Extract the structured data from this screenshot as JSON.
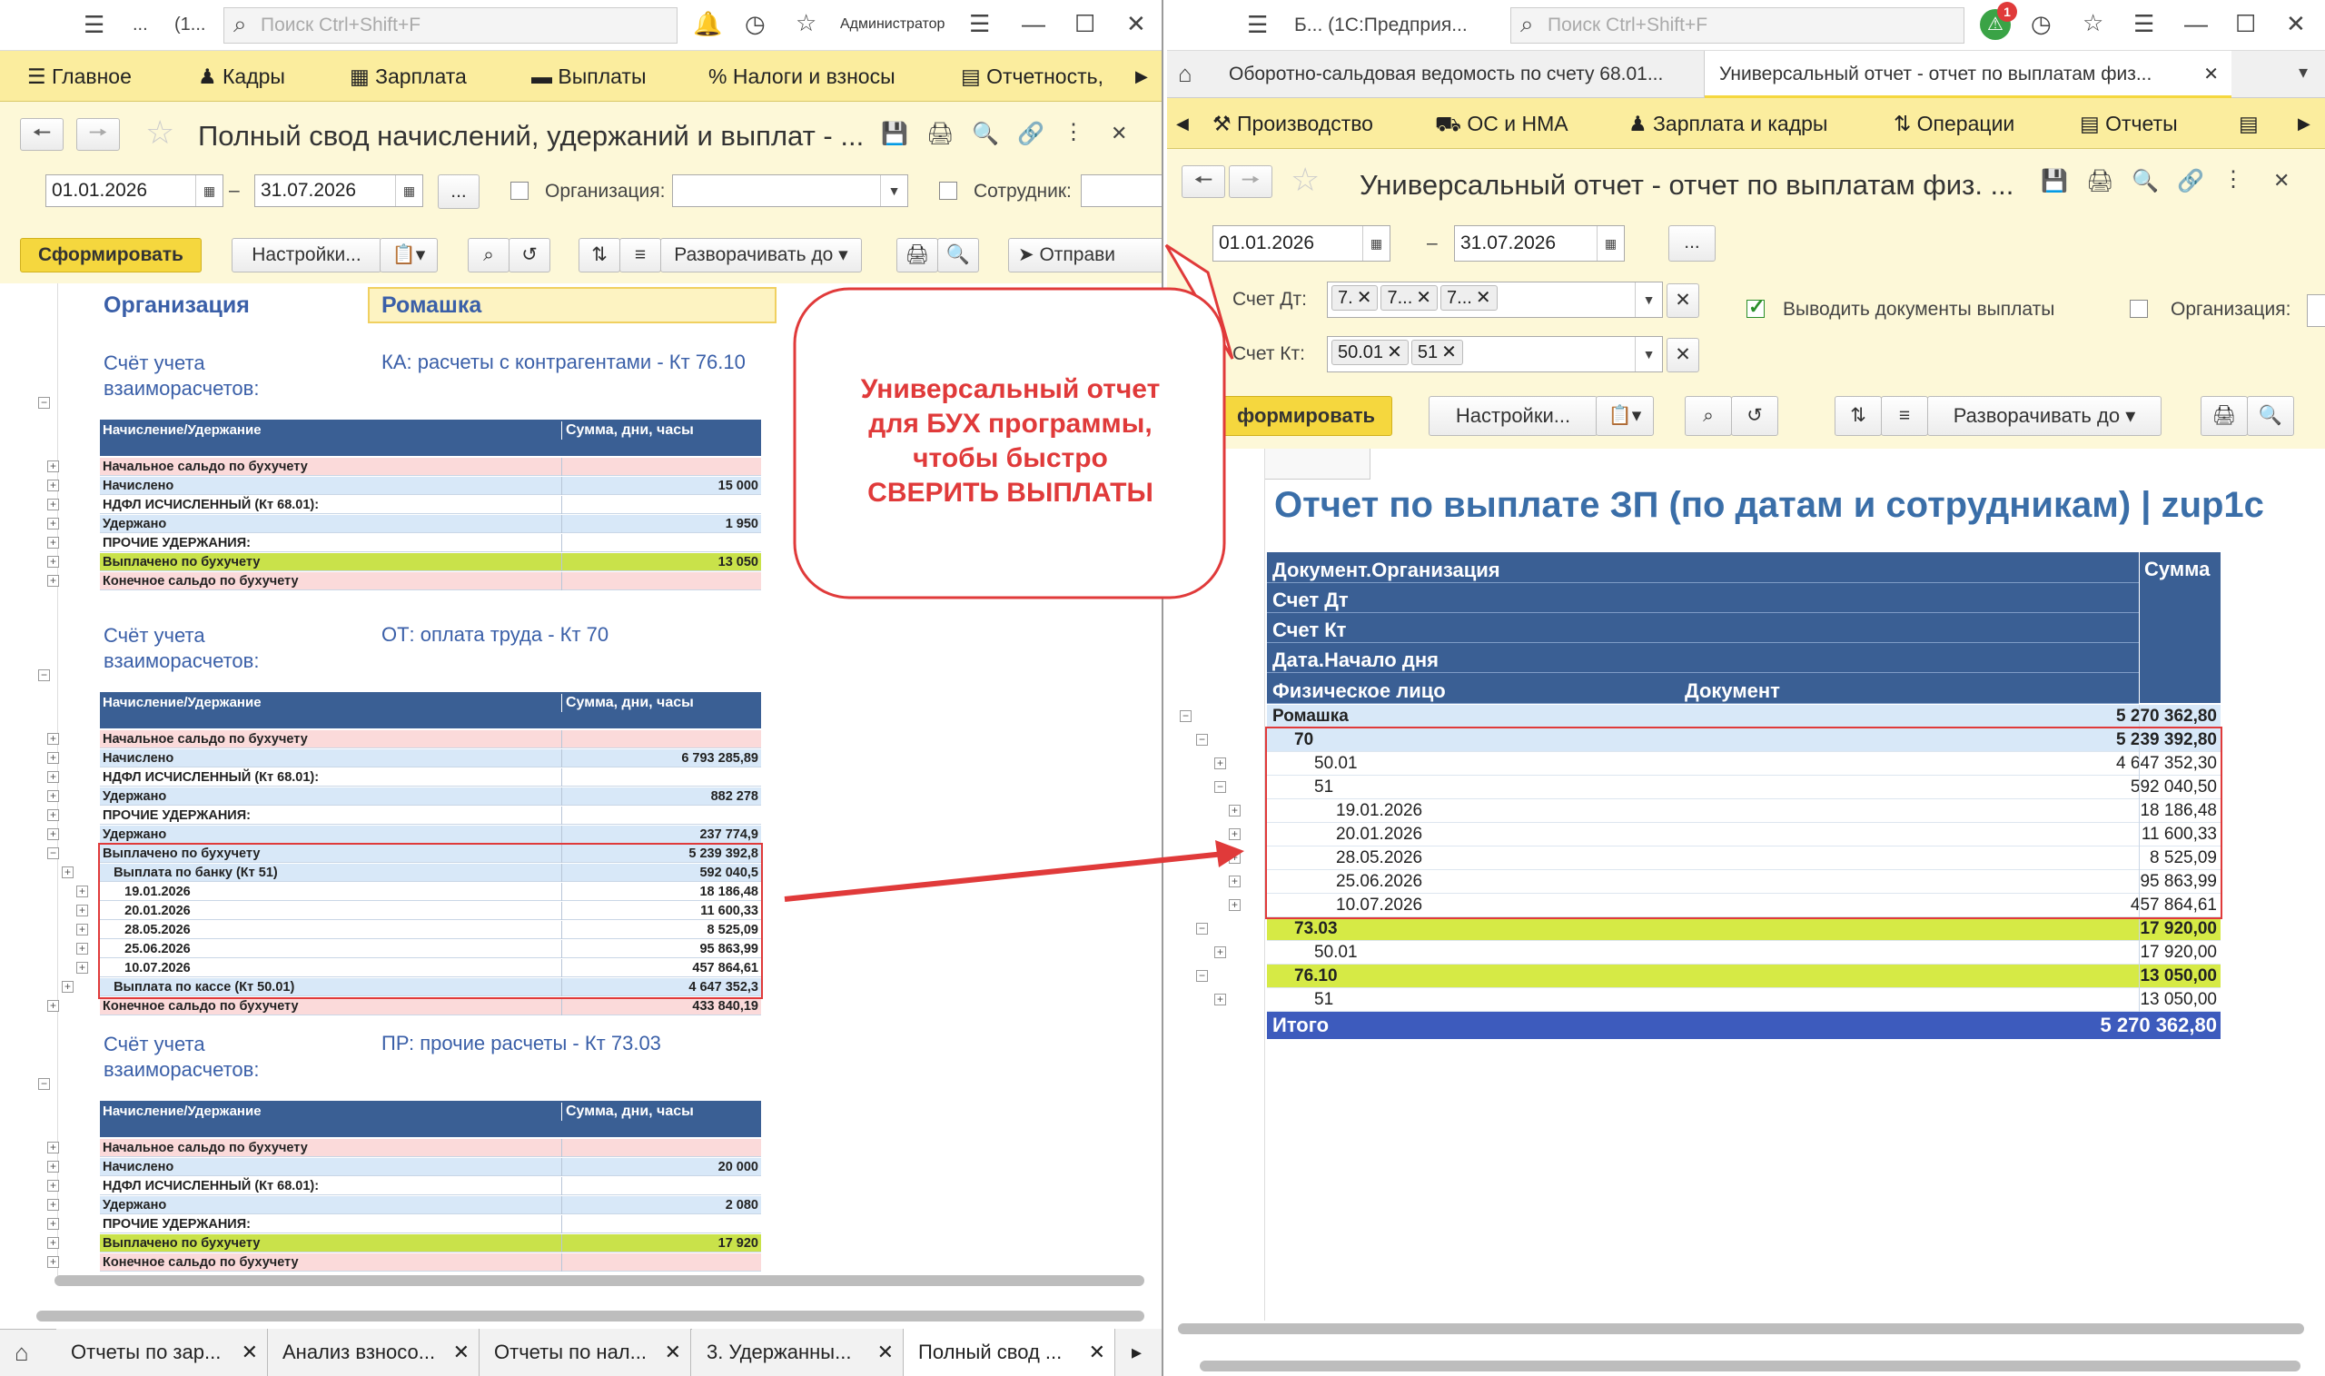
{
  "left": {
    "titlebar": {
      "search_placeholder": "Поиск Ctrl+Shift+F",
      "user": "Администратор",
      "dots": "...",
      "window_short": "(1..."
    },
    "sections": [
      {
        "label": "Главное"
      },
      {
        "label": "Кадры"
      },
      {
        "label": "Зарплата"
      },
      {
        "label": "Выплаты"
      },
      {
        "label": "Налоги и взносы"
      },
      {
        "label": "Отчетность,"
      }
    ],
    "report_title": "Полный свод начислений, удержаний и выплат - ...",
    "date_from": "01.01.2026",
    "date_to": "31.07.2026",
    "date_sep": "–",
    "more_btn": "...",
    "org_label": "Организация:",
    "emp_label": "Сотрудник:",
    "btn_generate": "Сформировать",
    "btn_settings": "Настройки...",
    "btn_expand": "Разворачивать до",
    "btn_send": "Отправи",
    "org_header": "Организация",
    "org_value": "Ромашка",
    "group_label": "Счёт учета\nвзаиморасчетов:",
    "table_hdr_left": "Начисление/Удержание",
    "table_hdr_right": "Сумма, дни, часы",
    "groups": [
      {
        "account": "КА: расчеты с контрагентами - Кт 76.10",
        "rows": [
          {
            "n": "Начальное сальдо по бухучету",
            "v": "",
            "bg": "#fbdada"
          },
          {
            "n": "Начислено",
            "v": "15 000",
            "bg": "#d8e8f8"
          },
          {
            "n": "НДФЛ ИСЧИСЛЕННЫЙ (Кт 68.01):",
            "v": "",
            "bg": "#fff"
          },
          {
            "n": "Удержано",
            "v": "1 950",
            "bg": "#d8e8f8"
          },
          {
            "n": "ПРОЧИЕ УДЕРЖАНИЯ:",
            "v": "",
            "bg": "#fff"
          },
          {
            "n": "Выплачено по бухучету",
            "v": "13 050",
            "bg": "#c9e24a"
          },
          {
            "n": "Конечное сальдо по бухучету",
            "v": "",
            "bg": "#fbdada"
          }
        ]
      },
      {
        "account": "ОТ: оплата труда - Кт 70",
        "rows": [
          {
            "n": "Начальное сальдо по бухучету",
            "v": "",
            "bg": "#fbdada"
          },
          {
            "n": "Начислено",
            "v": "6 793 285,89",
            "bg": "#d8e8f8"
          },
          {
            "n": "НДФЛ ИСЧИСЛЕННЫЙ (Кт 68.01):",
            "v": "",
            "bg": "#fff"
          },
          {
            "n": "Удержано",
            "v": "882 278",
            "bg": "#d8e8f8"
          },
          {
            "n": "ПРОЧИЕ УДЕРЖАНИЯ:",
            "v": "",
            "bg": "#fff"
          },
          {
            "n": "Удержано",
            "v": "237 774,9",
            "bg": "#d8e8f8"
          },
          {
            "n": "Выплачено по бухучету",
            "v": "5 239 392,8",
            "bg": "#d8e8f8"
          },
          {
            "n": "   Выплата по банку (Кт 51)",
            "v": "592 040,5",
            "bg": "#d8e8f8"
          },
          {
            "n": "      19.01.2026",
            "v": "18 186,48",
            "bg": "#fff"
          },
          {
            "n": "      20.01.2026",
            "v": "11 600,33",
            "bg": "#fff"
          },
          {
            "n": "      28.05.2026",
            "v": "8 525,09",
            "bg": "#fff"
          },
          {
            "n": "      25.06.2026",
            "v": "95 863,99",
            "bg": "#fff"
          },
          {
            "n": "      10.07.2026",
            "v": "457 864,61",
            "bg": "#fff"
          },
          {
            "n": "   Выплата по кассе (Кт 50.01)",
            "v": "4 647 352,3",
            "bg": "#d8e8f8"
          },
          {
            "n": "Конечное сальдо по бухучету",
            "v": "433 840,19",
            "bg": "#fbdada"
          }
        ]
      },
      {
        "account": "ПР: прочие расчеты - Кт 73.03",
        "rows": [
          {
            "n": "Начальное сальдо по бухучету",
            "v": "",
            "bg": "#fbdada"
          },
          {
            "n": "Начислено",
            "v": "20 000",
            "bg": "#d8e8f8"
          },
          {
            "n": "НДФЛ ИСЧИСЛЕННЫЙ (Кт 68.01):",
            "v": "",
            "bg": "#fff"
          },
          {
            "n": "Удержано",
            "v": "2 080",
            "bg": "#d8e8f8"
          },
          {
            "n": "ПРОЧИЕ УДЕРЖАНИЯ:",
            "v": "",
            "bg": "#fff"
          },
          {
            "n": "Выплачено по бухучету",
            "v": "17 920",
            "bg": "#c9e24a"
          },
          {
            "n": "Конечное сальдо по бухучету",
            "v": "",
            "bg": "#fbdada"
          }
        ]
      }
    ],
    "bottom_tabs": [
      "Отчеты по зар...",
      "Анализ взносо...",
      "Отчеты по нал...",
      "3. Удержанны...",
      "Полный свод ..."
    ]
  },
  "right": {
    "titlebar": {
      "app": "Б...  (1С:Предприя...",
      "search_placeholder": "Поиск Ctrl+Shift+F",
      "badge": "1"
    },
    "tabs": [
      "Оборотно-сальдовая ведомость по счету 68.01...",
      "Универсальный отчет - отчет по выплатам физ..."
    ],
    "sections": [
      {
        "label": "Производство"
      },
      {
        "label": "ОС и НМА"
      },
      {
        "label": "Зарплата и кадры"
      },
      {
        "label": "Операции"
      },
      {
        "label": "Отчеты"
      }
    ],
    "report_title": "Универсальный отчет - отчет по выплатам физ. ...",
    "date_from": "01.01.2026",
    "date_to": "31.07.2026",
    "date_sep": "–",
    "more_btn": "...",
    "dt_label": "Счет Дт:",
    "dt_tags": [
      "7.",
      "7...",
      "7..."
    ],
    "kt_label": "Счет Кт:",
    "kt_tags": [
      "50.01",
      "51"
    ],
    "show_docs_label": "Выводить документы выплаты",
    "org_label": "Организация:",
    "btn_generate": "формировать",
    "btn_settings": "Настройки...",
    "btn_expand": "Разворачивать до",
    "report_heading": "Отчет по выплате ЗП (по датам и сотрудникам) | zup1c",
    "hdr": {
      "org": "Документ.Организация",
      "dt": "Счет Дт",
      "kt": "Счет Кт",
      "date": "Дата.Начало дня",
      "person": "Физическое лицо",
      "doc": "Документ",
      "sum": "Сумма"
    },
    "rows": [
      {
        "n": "Ромашка",
        "v": "5 270 362,80",
        "lvl": 0,
        "bg": "#d8e8f8",
        "b": true
      },
      {
        "n": "70",
        "v": "5 239 392,80",
        "lvl": 1,
        "bg": "#d8e8f8",
        "b": true
      },
      {
        "n": "50.01",
        "v": "4 647 352,30",
        "lvl": 2,
        "bg": "#fff",
        "b": false
      },
      {
        "n": "51",
        "v": "592 040,50",
        "lvl": 2,
        "bg": "#fff",
        "b": false
      },
      {
        "n": "19.01.2026",
        "v": "18 186,48",
        "lvl": 3,
        "bg": "#fff",
        "b": false
      },
      {
        "n": "20.01.2026",
        "v": "11 600,33",
        "lvl": 3,
        "bg": "#fff",
        "b": false
      },
      {
        "n": "28.05.2026",
        "v": "8 525,09",
        "lvl": 3,
        "bg": "#fff",
        "b": false
      },
      {
        "n": "25.06.2026",
        "v": "95 863,99",
        "lvl": 3,
        "bg": "#fff",
        "b": false
      },
      {
        "n": "10.07.2026",
        "v": "457 864,61",
        "lvl": 3,
        "bg": "#fff",
        "b": false
      },
      {
        "n": "73.03",
        "v": "17 920,00",
        "lvl": 1,
        "bg": "#d6ea45",
        "b": true
      },
      {
        "n": "50.01",
        "v": "17 920,00",
        "lvl": 2,
        "bg": "#fff",
        "b": false
      },
      {
        "n": "76.10",
        "v": "13 050,00",
        "lvl": 1,
        "bg": "#d6ea45",
        "b": true
      },
      {
        "n": "51",
        "v": "13 050,00",
        "lvl": 2,
        "bg": "#fff",
        "b": false
      }
    ],
    "total_label": "Итого",
    "total_value": "5 270 362,80"
  },
  "callout": {
    "text": "Универсальный отчет\nдля БУХ программы,\nчтобы быстро\nСВЕРИТЬ ВЫПЛАТЫ",
    "color": "#e03a3a"
  }
}
